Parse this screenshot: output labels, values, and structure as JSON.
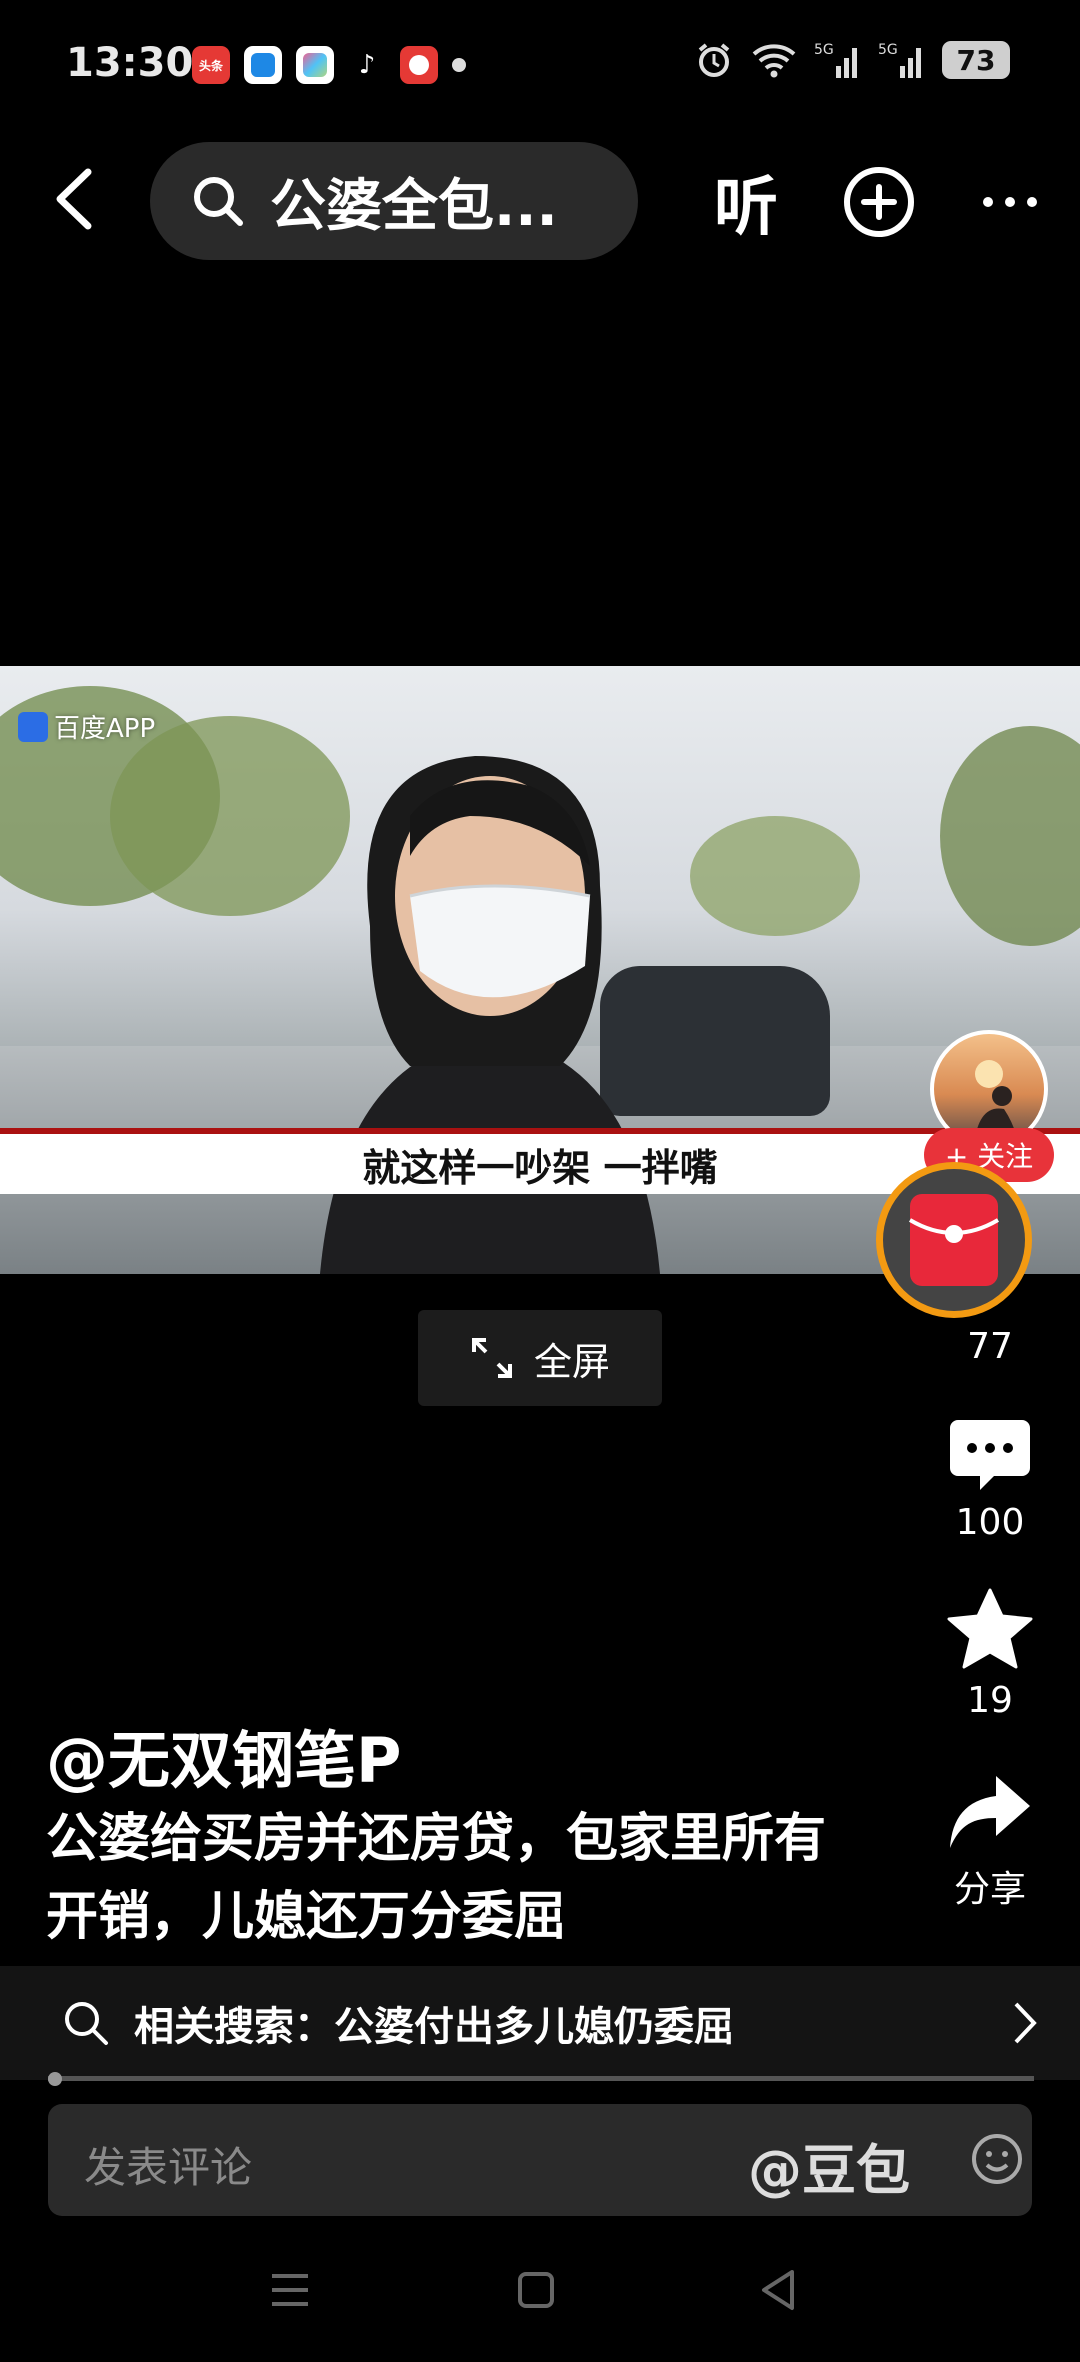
{
  "status": {
    "time": "13:30",
    "battery": "73"
  },
  "search": {
    "query": "公婆全包..."
  },
  "topbar": {
    "listen_label": "听"
  },
  "video": {
    "watermark": "百度APP",
    "subtitle": "就这样一吵架  一拌嘴",
    "fullscreen_label": "全屏"
  },
  "actions": {
    "follow_label": "+ 关注",
    "like_count": "77",
    "comment_count": "100",
    "favorite_count": "19",
    "share_label": "分享"
  },
  "post": {
    "author": "@无双钢笔P",
    "description": "公婆给买房并还房贷，包家里所有开销，儿媳还万分委屈"
  },
  "related": {
    "label": "相关搜索：公婆付出多儿媳仍委屈"
  },
  "comment": {
    "placeholder": "发表评论",
    "mention": "@豆包"
  },
  "apps": {
    "toutiao": "头条"
  }
}
